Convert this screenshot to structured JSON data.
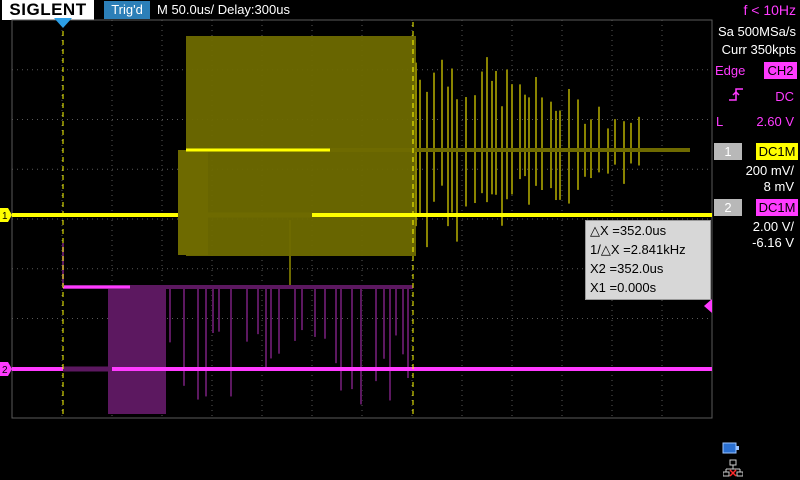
{
  "header": {
    "brand": "SIGLENT",
    "trigger_status": "Trig'd",
    "timebase": "M 50.0us/  Delay:300us",
    "frequency": "f < 10Hz"
  },
  "acquisition": {
    "sample_rate": "Sa 500MSa/s",
    "memory_depth": "Curr 350kpts"
  },
  "trigger": {
    "type": "Edge",
    "source": "CH2",
    "coupling": "DC",
    "level_label": "L",
    "level": "2.60 V"
  },
  "channels": [
    {
      "number": "1",
      "coupling": "DC1M",
      "scale": "200 mV/",
      "offset": "8 mV",
      "color": "#ffff00"
    },
    {
      "number": "2",
      "coupling": "DC1M",
      "scale": "2.00 V/",
      "offset": "-6.16 V",
      "color": "#ff3bff"
    }
  ],
  "cursors": {
    "delta_x": "△X =352.0us",
    "inv_delta_x": "1/△X =2.841kHz",
    "x2": "X2 =352.0us",
    "x1": "X1 =0.000s"
  },
  "markers": {
    "ch1": "1",
    "ch2": "2"
  },
  "colors": {
    "ch1": "#ffff00",
    "ch1_dim": "#6e6a00",
    "ch2": "#ff3bff",
    "ch2_dim": "#5c1860",
    "grid": "#5a5a5a",
    "trigger_marker": "#2c9fe6"
  },
  "icons": [
    "usb-icon",
    "lan-icon",
    "trigger-slope-rising-icon"
  ]
}
